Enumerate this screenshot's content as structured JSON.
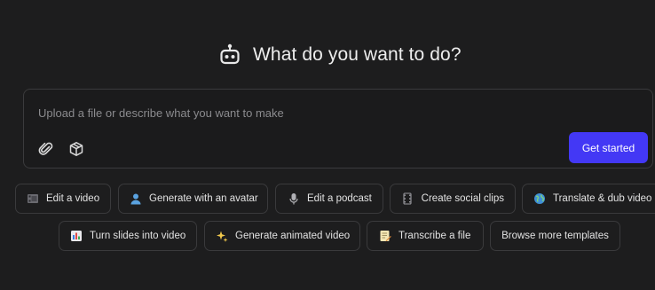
{
  "header": {
    "title": "What do you want to do?",
    "icon": "robot-icon"
  },
  "prompt": {
    "placeholder": "Upload a file or describe what you want to make",
    "value": "",
    "attach_icon": "paperclip-icon",
    "cube_icon": "cube-icon",
    "submit_label": "Get started",
    "accent_color": "#4338f5"
  },
  "actions_row1": [
    {
      "icon": "film-icon",
      "label": "Edit a video"
    },
    {
      "icon": "person-icon",
      "label": "Generate with an avatar"
    },
    {
      "icon": "microphone-icon",
      "label": "Edit a podcast"
    },
    {
      "icon": "clips-icon",
      "label": "Create social clips"
    },
    {
      "icon": "globe-icon",
      "label": "Translate & dub video"
    }
  ],
  "actions_row2": [
    {
      "icon": "bar-chart-icon",
      "label": "Turn slides into video"
    },
    {
      "icon": "sparkles-icon",
      "label": "Generate animated video"
    },
    {
      "icon": "memo-icon",
      "label": "Transcribe a file"
    },
    {
      "label": "Browse more templates"
    }
  ]
}
